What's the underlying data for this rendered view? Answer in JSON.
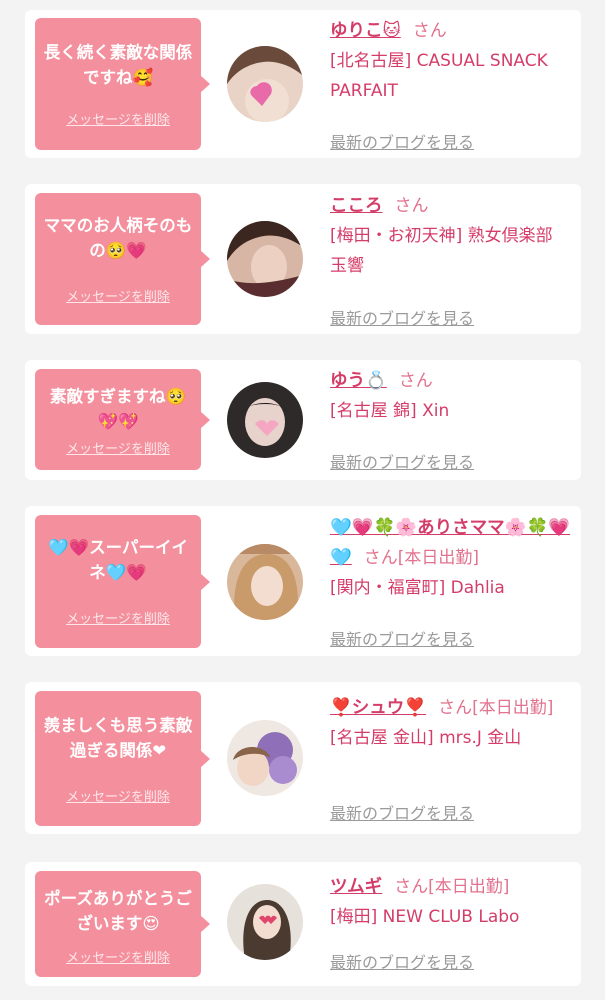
{
  "delete_label": "メッセージを削除",
  "blog_label": "最新のブログを見る",
  "san_label": "さん",
  "colors": {
    "bubble": "#f4909d",
    "name": "#d53d69",
    "shop": "#d53d69",
    "blog": "#9a9a9a",
    "background": "#f3f3f3"
  },
  "cards": [
    {
      "message": "長く続く素敵な関係ですね🥰",
      "name": "ゆりこ🐱",
      "status": "",
      "shop": "[北名古屋] CASUAL SNACK PARFAIT"
    },
    {
      "message": "ママのお人柄そのもの🥺💗",
      "name": "こころ",
      "status": "",
      "shop": "[梅田・お初天神] 熟女倶楽部 玉響"
    },
    {
      "message": "素敵すぎますね🥺💖💖",
      "name": "ゆう💍",
      "status": "",
      "shop": "[名古屋 錦] Xin"
    },
    {
      "message": "🩵💗スーパーイイネ🩵💗",
      "name": "🩵💗🍀🌸ありさママ🌸🍀💗🩵",
      "status": "[本日出勤]",
      "shop": "[関内・福富町] Dahlia"
    },
    {
      "message": "羨ましくも思う素敵過ぎる関係❤",
      "name": "❣️シュウ❣️",
      "status": "[本日出勤]",
      "shop": "[名古屋 金山] mrs.J 金山"
    },
    {
      "message": "ポーズありがとうございます😍",
      "name": "ツムギ",
      "status": "[本日出勤]",
      "shop": "[梅田] NEW CLUB Labo"
    }
  ]
}
